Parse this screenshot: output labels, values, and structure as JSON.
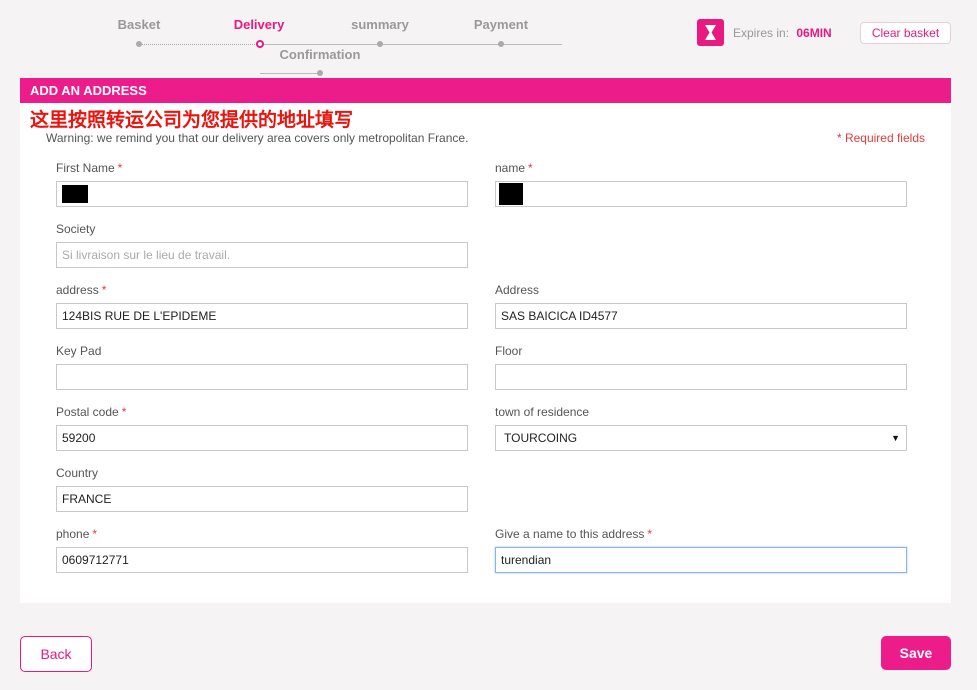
{
  "stepper": {
    "steps": [
      {
        "label": "Basket",
        "state": "done"
      },
      {
        "label": "Delivery",
        "state": "active"
      },
      {
        "label": "summary",
        "state": "pending"
      },
      {
        "label": "Payment",
        "state": "pending"
      },
      {
        "label": "Confirmation",
        "state": "pending"
      }
    ]
  },
  "timer": {
    "icon": "hourglass-icon",
    "label": "Expires in:",
    "value": "06MIN"
  },
  "clear_basket_label": "Clear basket",
  "panel": {
    "title": "ADD AN ADDRESS",
    "annotation": "这里按照转运公司为您提供的地址填写",
    "warning": "Warning: we remind you that our delivery area covers only metropolitan France.",
    "required_note": "* Required fields"
  },
  "form": {
    "first_name": {
      "label": "First Name",
      "value": ""
    },
    "name": {
      "label": "name",
      "value": ""
    },
    "society": {
      "label": "Society",
      "placeholder": "Si livraison sur le lieu de travail."
    },
    "address": {
      "label": "address",
      "value": "124BIS RUE DE L'EPIDEME"
    },
    "address2": {
      "label": "Address",
      "value": "SAS BAICICA  ID4577"
    },
    "keypad": {
      "label": "Key Pad",
      "value": ""
    },
    "floor": {
      "label": "Floor",
      "value": ""
    },
    "postal_code": {
      "label": "Postal code",
      "value": "59200"
    },
    "town": {
      "label": "town of residence",
      "value": "TOURCOING"
    },
    "country": {
      "label": "Country",
      "value": "FRANCE"
    },
    "phone": {
      "label": "phone",
      "value": "0609712771"
    },
    "address_name": {
      "label": "Give a name to this address",
      "value": "turendian"
    }
  },
  "buttons": {
    "back": "Back",
    "save": "Save"
  },
  "colors": {
    "accent": "#ec1c8b",
    "annotation": "#e8140f",
    "required": "#e23b3b"
  }
}
